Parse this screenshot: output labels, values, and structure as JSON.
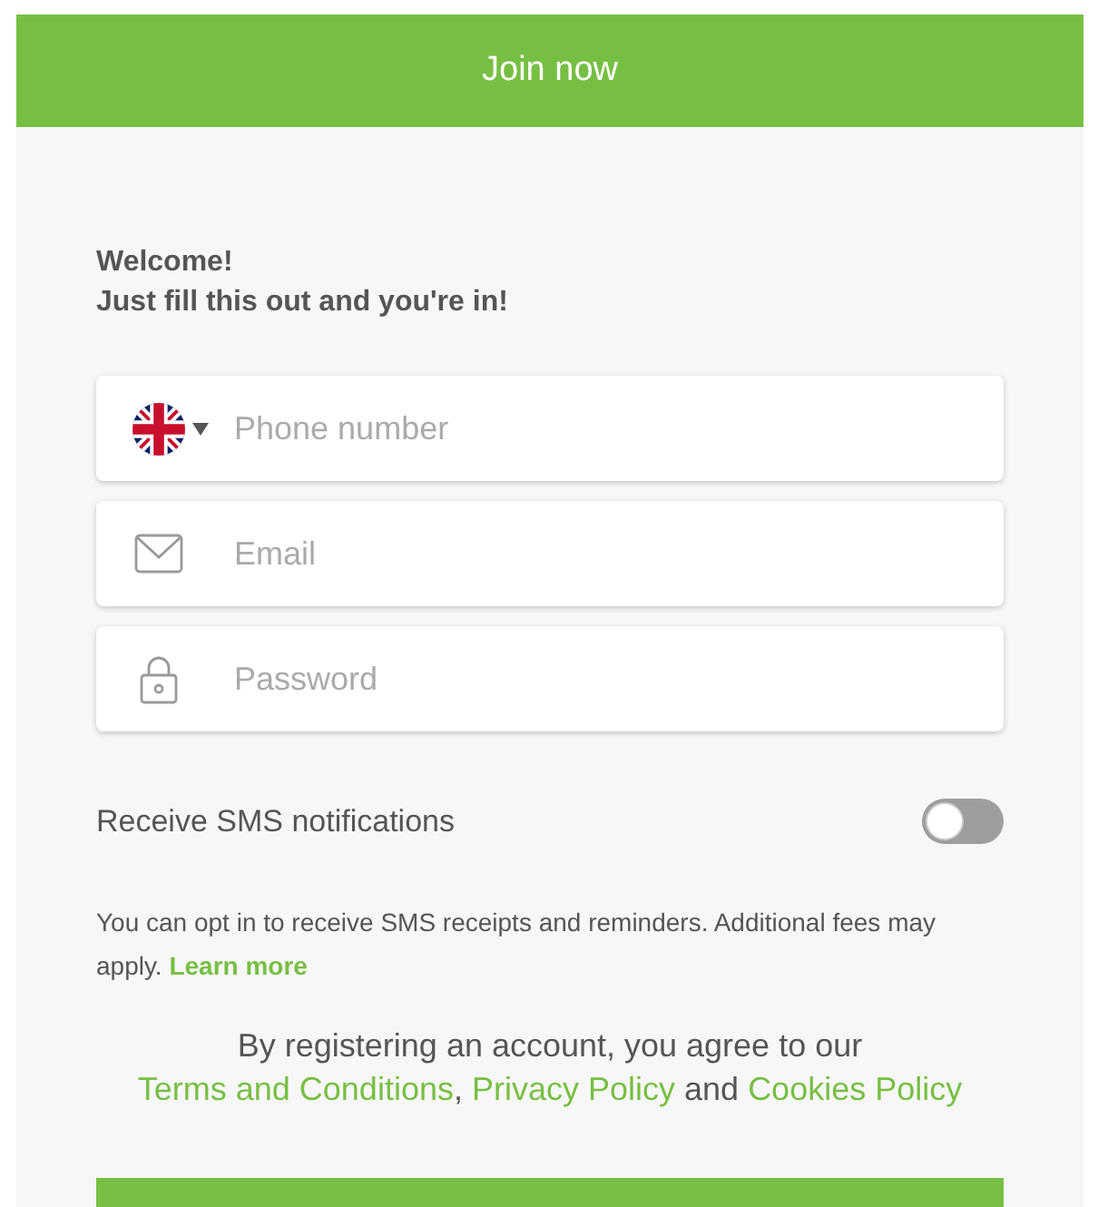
{
  "header": {
    "title": "Join now"
  },
  "welcome": [
    "Welcome!",
    "Just fill this out and you're in!"
  ],
  "fields": [
    {
      "kind": "phone",
      "placeholder": "Phone number"
    },
    {
      "kind": "email",
      "placeholder": "Email"
    },
    {
      "kind": "password",
      "placeholder": "Password"
    }
  ],
  "sms_toggle": {
    "label": "Receive SMS notifications",
    "on": false
  },
  "sms_note": {
    "text": "You can opt in to receive SMS receipts and reminders. Additional fees may apply.",
    "link": "Learn more"
  },
  "terms": [
    {
      "text": "By registering an account, you agree to our ",
      "link": false
    },
    {
      "text": "Terms and Conditions",
      "link": true
    },
    {
      "text": ", ",
      "link": false
    },
    {
      "text": "Privacy Policy",
      "link": true
    },
    {
      "text": " and ",
      "link": false
    },
    {
      "text": "Cookies Policy",
      "link": true
    }
  ]
}
